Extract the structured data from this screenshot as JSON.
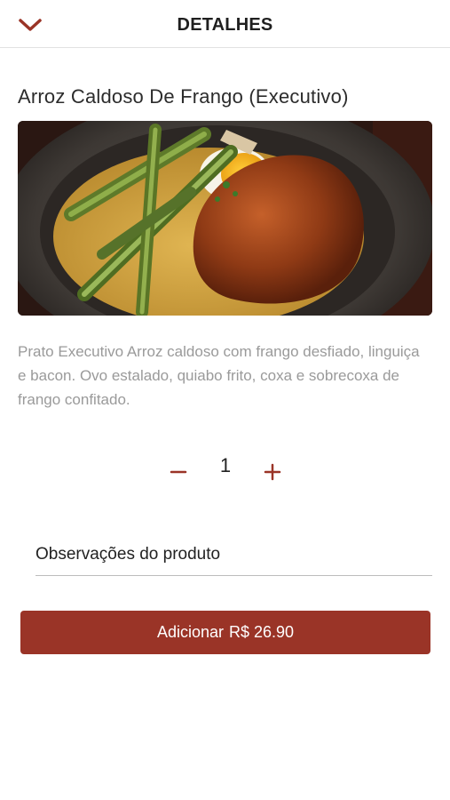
{
  "header": {
    "title": "DETALHES",
    "back_icon": "chevron-down-icon"
  },
  "product": {
    "title": "Arroz Caldoso De Frango (Executivo)",
    "image_alt": "Arroz caldoso com frango, ovo e quiabo",
    "description": "Prato Executivo Arroz caldoso com frango desfiado, linguiça e bacon. Ovo estalado, quiabo frito, coxa e sobrecoxa de frango confitado."
  },
  "quantity": {
    "value": "1",
    "minus_icon": "minus-icon",
    "plus_icon": "plus-icon"
  },
  "observations": {
    "placeholder": "Observações do produto",
    "value": ""
  },
  "add_button": {
    "label": "Adicionar",
    "price": "R$ 26.90"
  },
  "colors": {
    "accent": "#9a3427",
    "text_primary": "#2c2c2c",
    "text_muted": "#9a9a9a"
  }
}
